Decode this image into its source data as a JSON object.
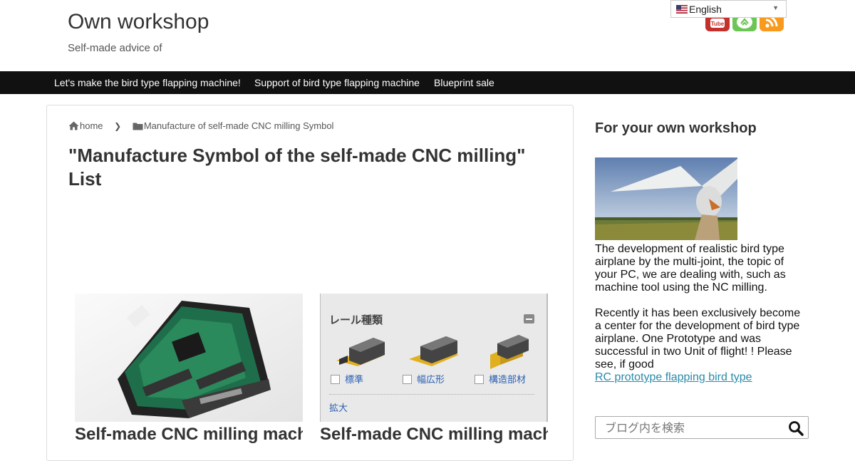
{
  "site": {
    "title": "Own workshop",
    "tagline": "Self-made advice of"
  },
  "language": {
    "selected": "English"
  },
  "sns": {
    "icons": [
      "youtube-icon",
      "feedly-icon",
      "rss-icon"
    ],
    "youtube_label": "You\nTube"
  },
  "nav": {
    "items": [
      "Let's make the bird type flapping machine!",
      "Support of bird type flapping machine",
      "Blueprint sale"
    ]
  },
  "breadcrumb": {
    "home": "home",
    "category": "Manufacture of self-made CNC milling Symbol"
  },
  "main": {
    "heading": "\"Manufacture Symbol of the self-made CNC milling\" List",
    "cards": [
      {
        "title": "Self-made CNC milling machine Works (Control)"
      },
      {
        "title": "Self-made CNC milling machine material"
      }
    ],
    "rail_panel": {
      "title": "レール種類",
      "options": [
        "標準",
        "幅広形",
        "構造部材"
      ],
      "zoom": "拡大"
    }
  },
  "sidebar": {
    "title": "For your own workshop",
    "paragraph1": "The development of realistic bird type airplane by the multi-joint, the topic of your PC, we are dealing with, such as machine tool using the NC milling.",
    "paragraph2": "Recently it has been exclusively become a center for the development of bird type airplane. One Prototype and was successful in two Unit of flight! ! Please see, if good",
    "link": "RC prototype flapping bird type",
    "search_placeholder": "ブログ内を検索"
  },
  "colors": {
    "nav_bg": "#111111",
    "link": "#2a8aaa",
    "youtube": "#c4302b",
    "feedly": "#6cc655",
    "rss": "#f89a1e"
  }
}
